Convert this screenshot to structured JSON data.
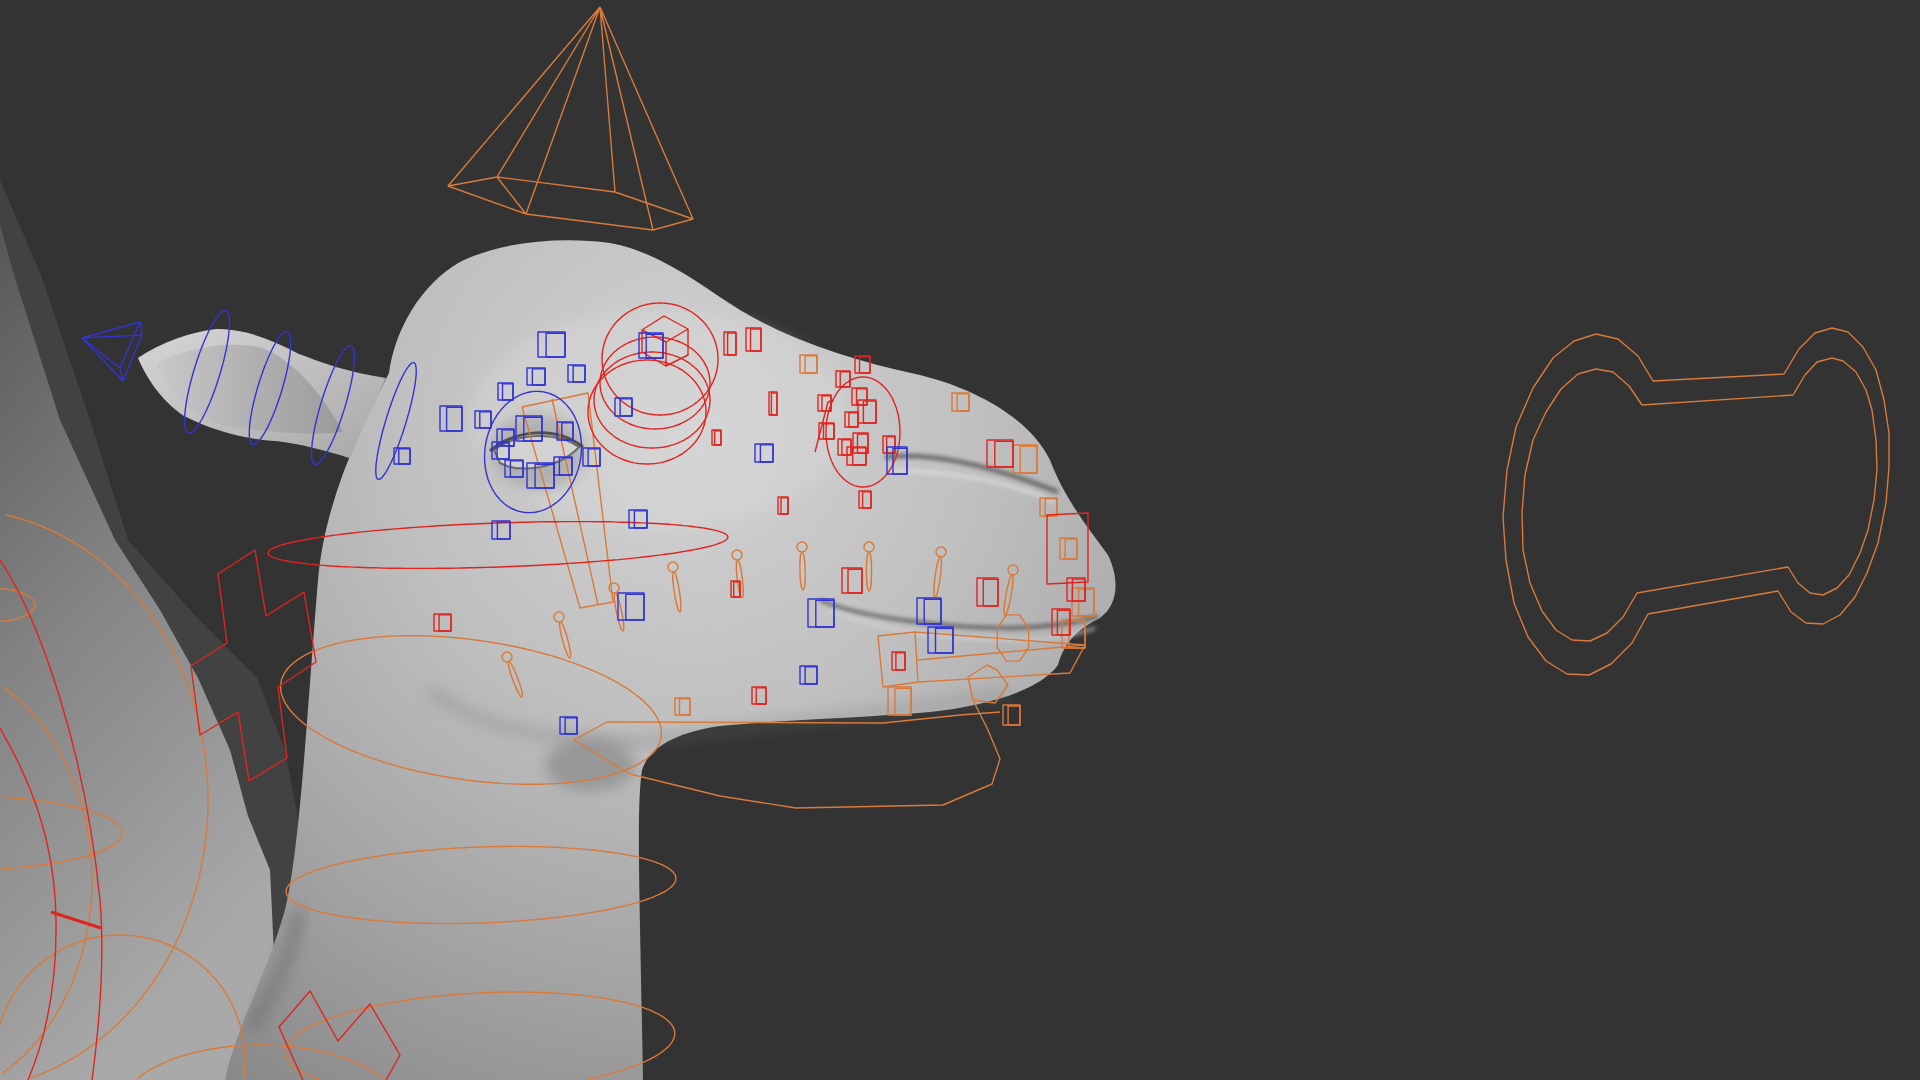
{
  "control_sets": [
    {
      "color": "#d97a3b"
    },
    {
      "color": "#e0241f"
    },
    {
      "color": "#3134d1"
    }
  ]
}
